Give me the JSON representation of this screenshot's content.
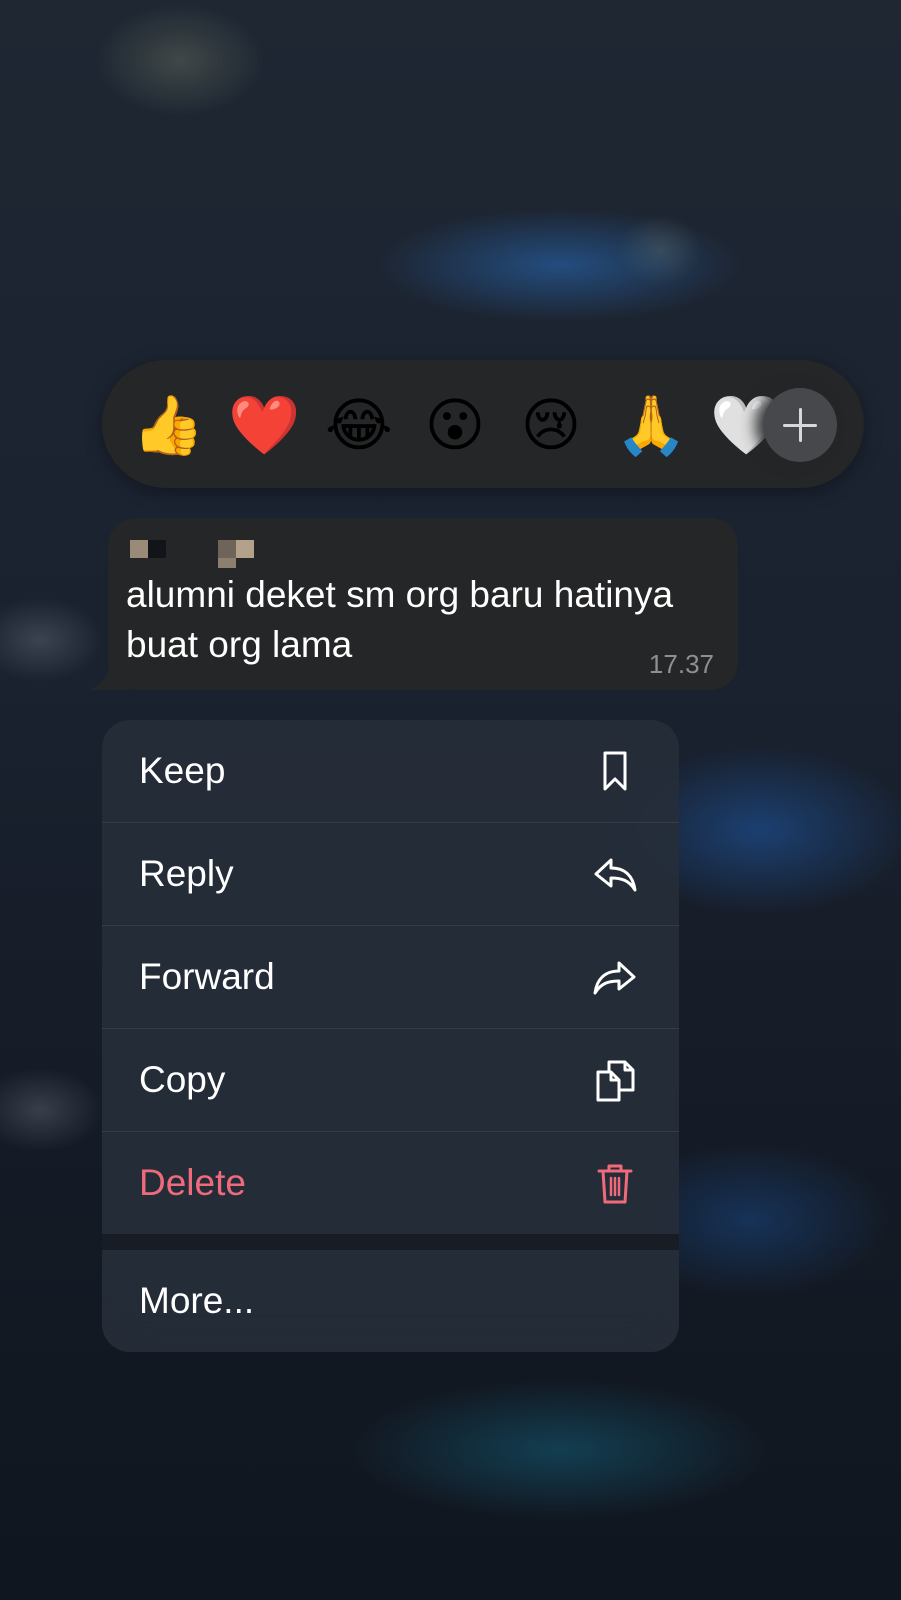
{
  "reactions": {
    "emojis": [
      "👍",
      "❤️",
      "😂",
      "😮",
      "😢",
      "🙏",
      "🤍"
    ],
    "more_icon": "plus-icon"
  },
  "message": {
    "text": "alumni deket sm org baru hatinya buat org lama",
    "time": "17.37"
  },
  "menu": {
    "items": [
      {
        "label": "Keep",
        "icon": "bookmark-icon"
      },
      {
        "label": "Reply",
        "icon": "reply-arrow-icon"
      },
      {
        "label": "Forward",
        "icon": "forward-arrow-icon"
      },
      {
        "label": "Copy",
        "icon": "copy-documents-icon"
      },
      {
        "label": "Delete",
        "icon": "trash-icon"
      }
    ],
    "more_label": "More..."
  },
  "colors": {
    "delete": "#ef6b7b",
    "bubble": "#252627",
    "menu": "#262e3a"
  }
}
